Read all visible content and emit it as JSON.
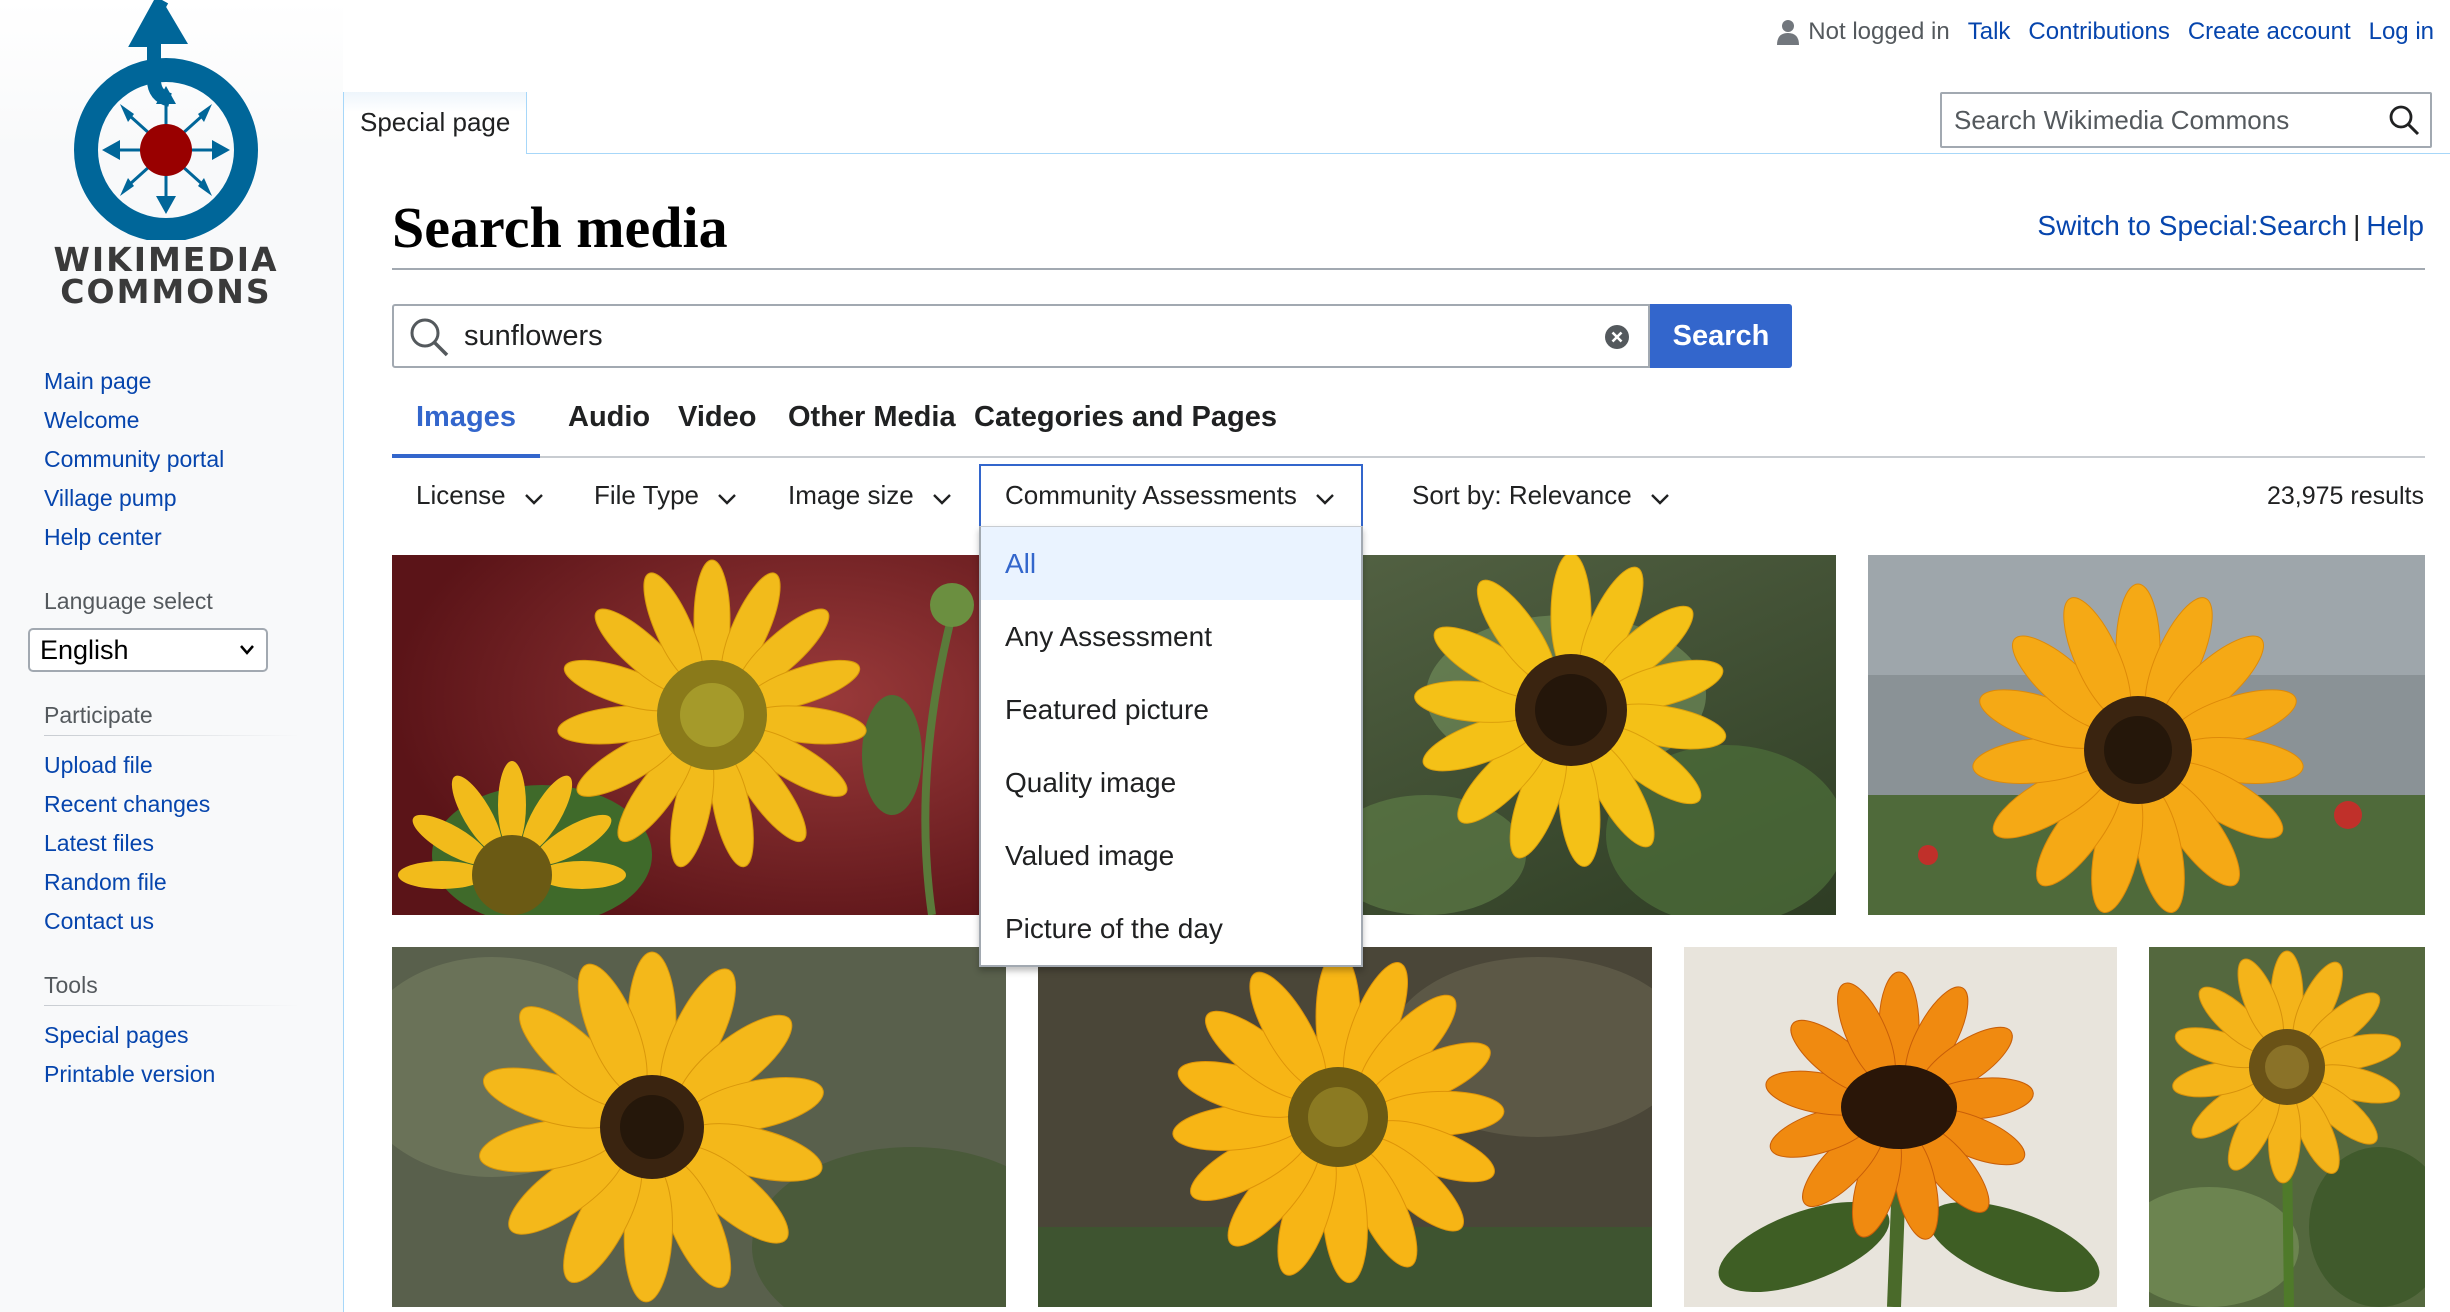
{
  "logo": {
    "line1": "WIKIMEDIA",
    "line2": "COMMONS"
  },
  "sidebar": {
    "navigation": [
      "Main page",
      "Welcome",
      "Community portal",
      "Village pump",
      "Help center"
    ],
    "language": {
      "heading": "Language select",
      "selected": "English"
    },
    "participate": {
      "heading": "Participate",
      "items": [
        "Upload file",
        "Recent changes",
        "Latest files",
        "Random file",
        "Contact us"
      ]
    },
    "tools": {
      "heading": "Tools",
      "items": [
        "Special pages",
        "Printable version"
      ]
    }
  },
  "personal": {
    "not_logged_in": "Not logged in",
    "links": [
      "Talk",
      "Contributions",
      "Create account",
      "Log in"
    ]
  },
  "header": {
    "tab_label": "Special page",
    "search_placeholder": "Search Wikimedia Commons"
  },
  "page": {
    "title": "Search media",
    "indicator_switch": "Switch to Special:Search",
    "indicator_sep": "|",
    "indicator_help": "Help"
  },
  "search": {
    "query": "sunflowers",
    "button_label": "Search"
  },
  "media_tabs": [
    "Images",
    "Audio",
    "Video",
    "Other Media",
    "Categories and Pages"
  ],
  "active_tab": "Images",
  "filters": {
    "license": "License",
    "file_type": "File Type",
    "image_size": "Image size",
    "assessments": "Community Assessments",
    "sort": "Sort by: Relevance"
  },
  "results_count": "23,975 results",
  "assessment_options": [
    "All",
    "Any Assessment",
    "Featured picture",
    "Quality image",
    "Valued image",
    "Picture of the day"
  ],
  "assessment_selected": "All",
  "colors": {
    "link": "#0645ad",
    "accent": "#3366cc",
    "selected_bg": "#eaf3ff",
    "logo_blue": "#006699",
    "logo_red": "#990000"
  }
}
